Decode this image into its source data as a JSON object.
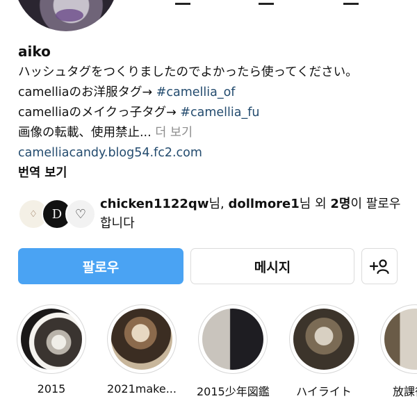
{
  "profile": {
    "username": "aiko",
    "bio_line1": "ハッシュタグをつくりましたのでよかったら使ってください。",
    "bio_line2_text": "camelliaのお洋服タグ→ ",
    "bio_line2_tag": "#camellia_of",
    "bio_line3_text": "camelliaのメイクっ子タグ→ ",
    "bio_line3_tag": "#camellia_fu",
    "bio_line4_text": "画像の転載、使用禁止... ",
    "bio_line4_more": "더 보기",
    "website": "camelliacandy.blog54.fc2.com",
    "translate_label": "번역 보기"
  },
  "followers": {
    "name1": "chicken1122qw",
    "suffix1": "님, ",
    "name2": "dollmore1",
    "suffix2": "님 외 ",
    "count": "2명",
    "suffix3": "이 팔로우합니다"
  },
  "actions": {
    "follow_label": "팔로우",
    "message_label": "메시지",
    "add_icon": "add-person-icon"
  },
  "highlights": [
    {
      "label": "2015"
    },
    {
      "label": "2021make..."
    },
    {
      "label": "2015少年図鑑"
    },
    {
      "label": "ハイライト"
    },
    {
      "label": "放課後図"
    }
  ],
  "colors": {
    "follow_button": "#4aa3f3",
    "link": "#234b6e",
    "muted": "#8e8e8e",
    "border": "#dbdbdb"
  }
}
